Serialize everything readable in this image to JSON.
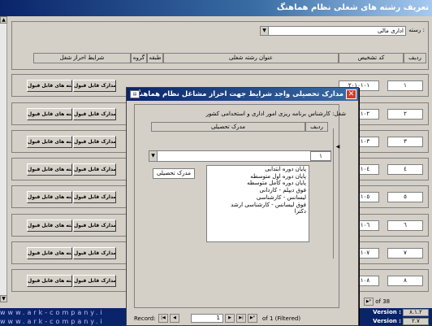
{
  "window": {
    "title": "تعریف رشته های شغلی نظام هماهنگ"
  },
  "header": {
    "series_label": "رسته :",
    "series_value": "اداری مالی",
    "col_row": "ردیف",
    "col_code": "کد تشخیص",
    "col_title": "عنوان رشته شغلی",
    "col_class": "طبقه",
    "col_group": "گروه",
    "col_conditions": "شرایط احراز شغل"
  },
  "rows": [
    {
      "num": "۱",
      "code": "۲۰۱۰۱۰۱",
      "btn_fields": "رشته های قابل قبول",
      "btn_docs": "مدارک قابل قبول"
    },
    {
      "num": "۲",
      "code": "۲۰۱۰۱۰۲",
      "btn_fields": "رشته های قابل قبول",
      "btn_docs": "مدارک قابل قبول"
    },
    {
      "num": "۳",
      "code": "۲۰۱۰۱۰۳",
      "btn_fields": "رشته های قابل قبول",
      "btn_docs": "مدارک قابل قبول"
    },
    {
      "num": "٤",
      "code": "۲۰۱۰۱۰٤",
      "btn_fields": "رشته های قابل قبول",
      "btn_docs": "مدارک قابل قبول"
    },
    {
      "num": "٥",
      "code": "۲۰۱۰۱۰٥",
      "btn_fields": "رشته های قابل قبول",
      "btn_docs": "مدارک قابل قبول"
    },
    {
      "num": "٦",
      "code": "۲۰۱۰۱۰٦",
      "btn_fields": "رشته های قابل قبول",
      "btn_docs": "مدارک قابل قبول"
    },
    {
      "num": "۷",
      "code": "۲۰۱۰۱۰۷",
      "btn_fields": "رشته های قابل قبول",
      "btn_docs": "مدارک قابل قبول"
    },
    {
      "num": "۸",
      "code": "۲۰۱۰۱۰۸",
      "btn_fields": "رشته های قابل قبول",
      "btn_docs": "مدارک قابل قبول"
    }
  ],
  "main_nav": {
    "of_text": "of 38"
  },
  "footer": [
    {
      "brand": "www.ark-company.i",
      "version_label": "Version :",
      "version_value": "۸.۱.۲"
    },
    {
      "brand": "www.ark-company.i",
      "version_label": "Version :",
      "version_value": "۲.۷"
    }
  ],
  "dialog": {
    "title": "مدارک تحصیلی واجد شرایط جهت احراز مشاغل نظام هماهنگ",
    "job_label": "شغل:",
    "job_value": "کارشناس برنامه ریزی امور اداری و استخدامی کشور",
    "col_row": "ردیف",
    "col_degree": "مدرک تحصیلی",
    "row_index": "۱",
    "degree_button": "مدرک تحصیلی",
    "options": [
      "پایان دوره ابتدایی",
      "پایان دوره اول متوسطه",
      "پایان دوره کامل متوسطه",
      "فوق دیپلم - کاردانی",
      "لیسانس - کارشناسی",
      "فوق لیسانس - کارشناسی ارشد",
      "دکترا"
    ],
    "record": {
      "label": "Record:",
      "current": "1",
      "of_text": "of 1 (Filtered)"
    }
  }
}
